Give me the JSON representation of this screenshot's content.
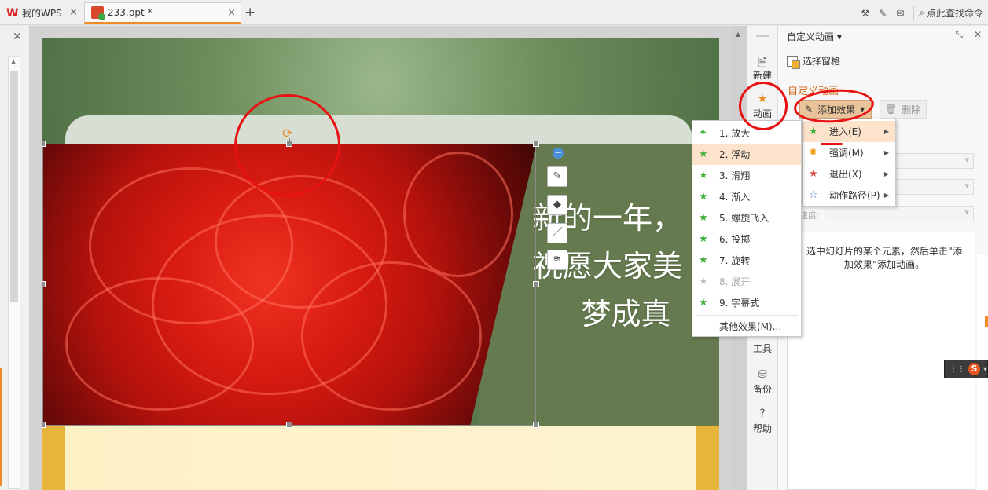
{
  "tabs": [
    {
      "label": "我的WPS",
      "close": "×"
    },
    {
      "label": "233.ppt *",
      "close": "×"
    }
  ],
  "new_tab": "+",
  "topbar": {
    "command_search": "点此查找命令"
  },
  "slide": {
    "text_line1": "新的一年，",
    "text_line2": "祝愿大家美",
    "text_line3": "梦成真"
  },
  "side_icons": [
    {
      "label": "新建",
      "icon": "new-file-icon"
    },
    {
      "label": "动画",
      "icon": "animation-icon"
    },
    {
      "label": "工具",
      "icon": "tools-icon"
    },
    {
      "label": "备份",
      "icon": "backup-icon"
    },
    {
      "label": "帮助",
      "icon": "help-icon"
    }
  ],
  "pane": {
    "title": "自定义动画",
    "select_pane": "选择窗格",
    "section_label": "自定义动画",
    "add_effect": "添加效果",
    "delete": "删除",
    "speed_label": "速度:",
    "hint": "选中幻灯片的某个元素，然后单击“添加效果”添加动画。"
  },
  "menu_main": [
    {
      "label": "进入(E)",
      "color": "#3fae3a"
    },
    {
      "label": "强调(M)",
      "color": "#f0a020"
    },
    {
      "label": "退出(X)",
      "color": "#e05050"
    },
    {
      "label": "动作路径(P)",
      "color": "#4a78c8"
    }
  ],
  "menu_enter": [
    {
      "label": "1. 放大"
    },
    {
      "label": "2. 浮动"
    },
    {
      "label": "3. 滑翔"
    },
    {
      "label": "4. 渐入"
    },
    {
      "label": "5. 螺旋飞入"
    },
    {
      "label": "6. 投掷"
    },
    {
      "label": "7. 旋转"
    },
    {
      "label": "8. 展开"
    },
    {
      "label": "9. 字幕式"
    },
    {
      "label": "其他效果(M)..."
    }
  ],
  "colors": {
    "accent": "#f08a24",
    "annotation": "#e81212",
    "highlight": "#fde3cc"
  }
}
